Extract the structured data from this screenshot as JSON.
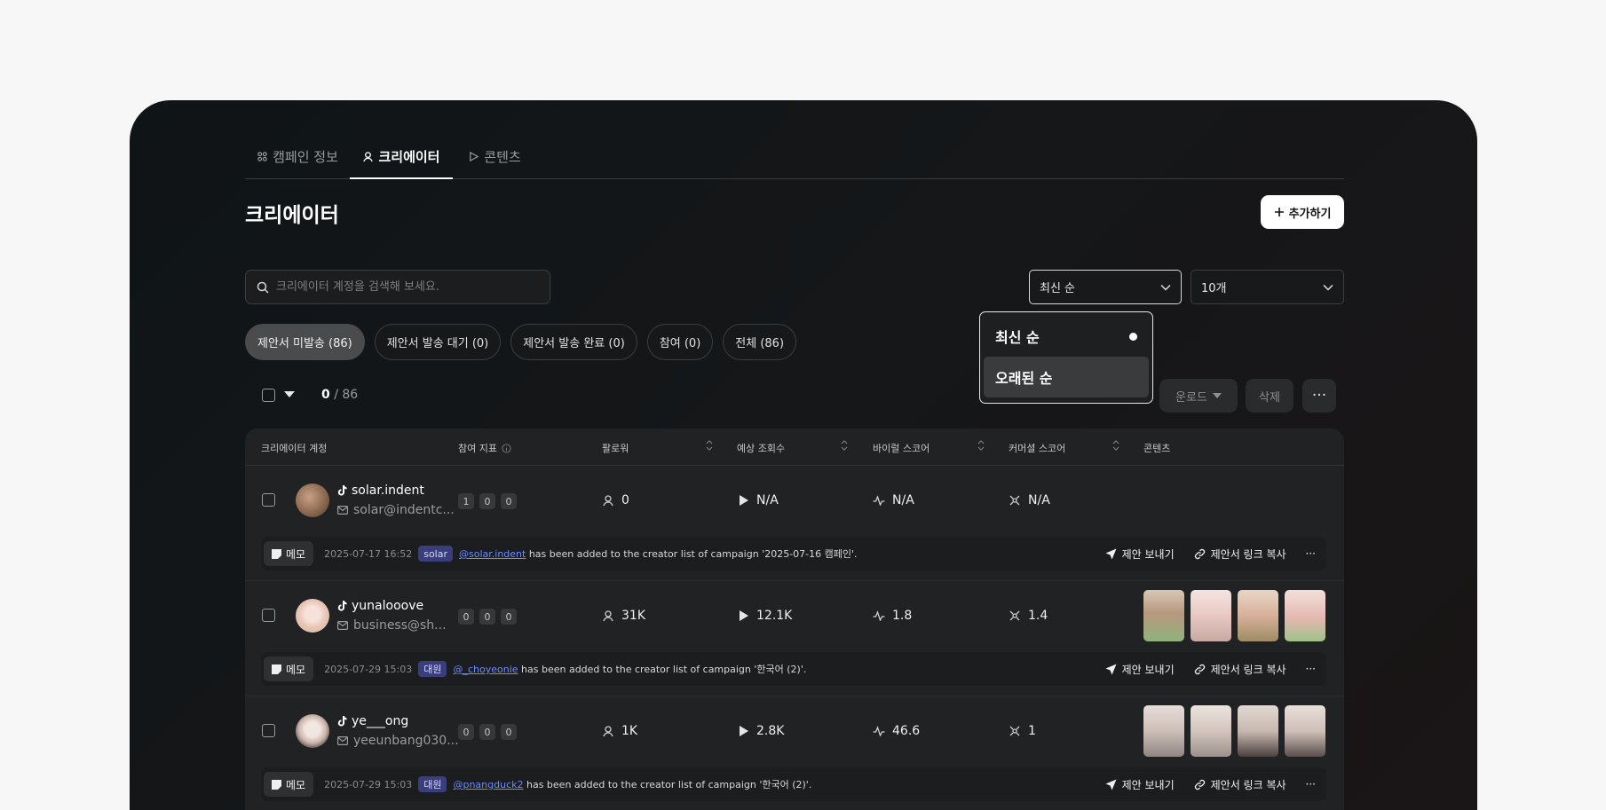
{
  "tabs": [
    {
      "label": "캠페인 정보",
      "icon": "campaign-icon"
    },
    {
      "label": "크리에이터",
      "icon": "user-icon"
    },
    {
      "label": "콘텐츠",
      "icon": "play-icon"
    }
  ],
  "page_title": "크리에이터",
  "add_button": "추가하기",
  "search": {
    "placeholder": "크리에이터 계정을 검색해 보세요."
  },
  "sort_select": {
    "value": "최신 순"
  },
  "count_select": {
    "value": "10개"
  },
  "filter_chips": [
    {
      "label": "제안서 미발송 (86)",
      "active": true
    },
    {
      "label": "제안서 발송 대기 (0)",
      "active": false
    },
    {
      "label": "제안서 발송 완료 (0)",
      "active": false
    },
    {
      "label": "참여 (0)",
      "active": false
    },
    {
      "label": "전체 (86)",
      "active": false
    }
  ],
  "selection": {
    "selected": "0",
    "total": " / 86"
  },
  "actions": {
    "download": "운로드",
    "delete": "삭제",
    "more": "···"
  },
  "columns": {
    "account": "크리에이터 계정",
    "engagement": "참여 지표",
    "followers": "팔로워",
    "expected_views": "예상 조회수",
    "viral_score": "바이럴 스코어",
    "commercial_score": "커머셜 스코어",
    "contents": "콘텐츠"
  },
  "rows": [
    {
      "handle": "solar.indent",
      "email": "solar@indentc...",
      "metrics": [
        "1",
        "0",
        "0"
      ],
      "followers": "0",
      "views": "N/A",
      "viral": "N/A",
      "commercial": "N/A",
      "memo": {
        "button": "메모",
        "date": "2025-07-17 16:52",
        "tag": "solar",
        "mention": "@solar.indent",
        "text": " has been added to the creator list of campaign '2025-07-16 캠페인'."
      }
    },
    {
      "handle": "yunalooove",
      "email": "business@sh...",
      "metrics": [
        "0",
        "0",
        "0"
      ],
      "followers": "31K",
      "views": "12.1K",
      "viral": "1.8",
      "commercial": "1.4",
      "memo": {
        "button": "메모",
        "date": "2025-07-29 15:03",
        "tag": "대원",
        "mention": "@_choyeonie",
        "text": " has been added to the creator list of campaign '한국어 (2)'."
      }
    },
    {
      "handle": "ye___ong",
      "email": "yeeunbang030...",
      "metrics": [
        "0",
        "0",
        "0"
      ],
      "followers": "1K",
      "views": "2.8K",
      "viral": "46.6",
      "commercial": "1",
      "memo": {
        "button": "메모",
        "date": "2025-07-29 15:03",
        "tag": "대원",
        "mention": "@pnangduck2",
        "text": " has been added to the creator list of campaign '한국어 (2)'."
      }
    }
  ],
  "memo_actions": {
    "send": "제안 보내기",
    "copy_link": "제안서 링크 복사",
    "more": "···"
  },
  "sort_dropdown": {
    "options": [
      "최신 순",
      "오래된 순"
    ],
    "selected": "최신 순"
  }
}
